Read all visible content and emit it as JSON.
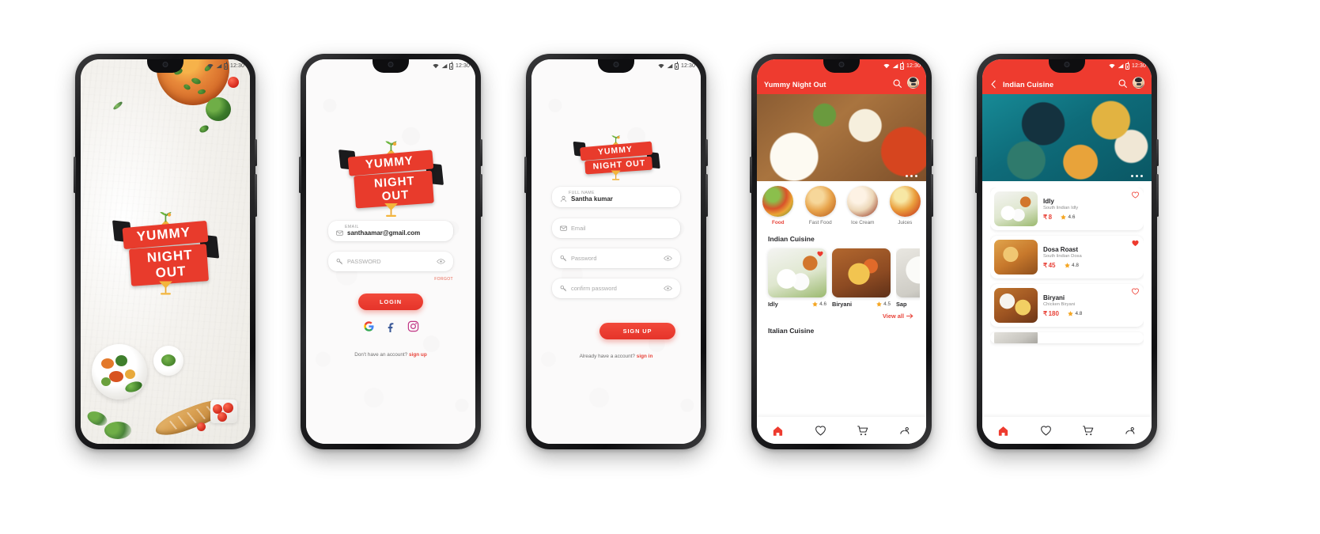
{
  "brand": {
    "name": "YUMMY",
    "name2": "NIGHT OUT",
    "accent": "#ee3b2f",
    "accent_dark": "#e5342a",
    "muted": "#9a9a9a"
  },
  "status_bar": {
    "time": "12:30"
  },
  "screens": {
    "splash": {
      "name": "splash-screen",
      "logo_top": "YUMMY",
      "logo_bottom": "NIGHT OUT"
    },
    "login": {
      "name": "login-screen",
      "logo_top": "YUMMY",
      "logo_bottom": "NIGHT OUT",
      "email": {
        "label": "EMAIL",
        "value": "santhaamar@gmail.com",
        "icon": "mail-icon"
      },
      "password": {
        "placeholder": "PASSWORD",
        "icon": "key-icon",
        "toggle_icon": "eye-icon"
      },
      "forgot": "FORGOT",
      "login_button": "LOGIN",
      "socials": [
        {
          "name": "google-icon",
          "label": "G"
        },
        {
          "name": "facebook-icon",
          "label": "f"
        },
        {
          "name": "instagram-icon",
          "label": "ig"
        }
      ],
      "footer_text": "Don't have an account?",
      "footer_link": "sign up"
    },
    "signup": {
      "name": "signup-screen",
      "logo_top": "YUMMY",
      "logo_bottom": "NIGHT OUT",
      "fullname": {
        "label": "FULL NAME",
        "value": "Santha kumar",
        "icon": "user-icon"
      },
      "email": {
        "placeholder": "Email",
        "icon": "mail-icon"
      },
      "password": {
        "placeholder": "Password",
        "icon": "key-icon",
        "toggle_icon": "eye-icon"
      },
      "confirm": {
        "placeholder": "confirm password",
        "icon": "key-icon",
        "toggle_icon": "eye-icon"
      },
      "signup_button": "SIGN UP",
      "footer_text": "Already have a account?",
      "footer_link": "sign in"
    },
    "home": {
      "name": "home-screen",
      "appbar": {
        "title": "Yummy Night Out",
        "search_icon": "search-icon",
        "avatar": "avatar"
      },
      "categories": [
        {
          "label": "Food",
          "active": true
        },
        {
          "label": "Fast Food",
          "active": false
        },
        {
          "label": "Ice Cream",
          "active": false
        },
        {
          "label": "Juices",
          "active": false
        }
      ],
      "indian": {
        "title": "Indian Cuisine",
        "items": [
          {
            "name": "Idly",
            "rating": "4.6",
            "fav": true
          },
          {
            "name": "Biryani",
            "rating": "4.5",
            "fav": false
          },
          {
            "name": "Sap",
            "rating": "",
            "fav": false
          }
        ],
        "view_all": "View all"
      },
      "italian": {
        "title": "Italian Cuisine"
      },
      "tabs": [
        {
          "name": "home-tab",
          "icon": "home-icon",
          "active": true
        },
        {
          "name": "favourites-tab",
          "icon": "heart-icon",
          "active": false
        },
        {
          "name": "cart-tab",
          "icon": "cart-icon",
          "active": false
        },
        {
          "name": "profile-tab",
          "icon": "profile-icon",
          "active": false
        }
      ]
    },
    "cuisine": {
      "name": "indian-cuisine-screen",
      "appbar": {
        "back_icon": "back-arrow-icon",
        "title": "Indian Cuisine",
        "search_icon": "search-icon",
        "avatar": "avatar"
      },
      "currency": "₹",
      "items": [
        {
          "name": "Idly",
          "desc": "South lindian Idly",
          "price": "8",
          "rating": "4.6",
          "fav": true
        },
        {
          "name": "Dosa Roast",
          "desc": "South lindian Dosa",
          "price": "45",
          "rating": "4.8",
          "fav": true
        },
        {
          "name": "Biryani",
          "desc": "Chicken Biryani",
          "price": "180",
          "rating": "4.8",
          "fav": false
        },
        {
          "name": "",
          "desc": "",
          "price": "",
          "rating": "",
          "fav": false
        }
      ],
      "tabs": [
        {
          "name": "home-tab",
          "icon": "home-icon",
          "active": true
        },
        {
          "name": "favourites-tab",
          "icon": "heart-icon",
          "active": false
        },
        {
          "name": "cart-tab",
          "icon": "cart-icon",
          "active": false
        },
        {
          "name": "profile-tab",
          "icon": "profile-icon",
          "active": false
        }
      ]
    }
  }
}
